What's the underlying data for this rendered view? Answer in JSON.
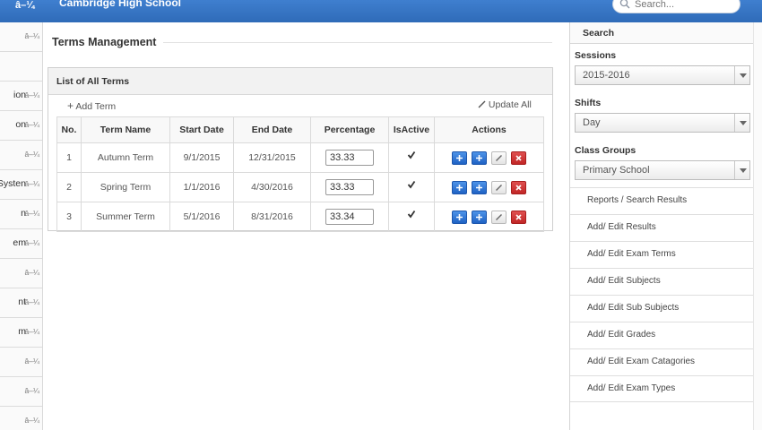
{
  "header": {
    "glyph": "â–¼",
    "school_name": "Cambridge High School",
    "search_placeholder": "Search..."
  },
  "left_nav": {
    "items": [
      {
        "label": "",
        "glyph": "â–¼"
      },
      {
        "label": "",
        "glyph": ""
      },
      {
        "label": "ion",
        "glyph": "â–¼"
      },
      {
        "label": "on",
        "glyph": "â–¼"
      },
      {
        "label": "",
        "glyph": "â–¼"
      },
      {
        "label": "Systen",
        "glyph": "â–¼"
      },
      {
        "label": "n",
        "glyph": "â–¼"
      },
      {
        "label": "em",
        "glyph": "â–¼"
      },
      {
        "label": "",
        "glyph": "â–¼"
      },
      {
        "label": "nt",
        "glyph": "â–¼"
      },
      {
        "label": "m",
        "glyph": "â–¼"
      },
      {
        "label": "",
        "glyph": "â–¼"
      },
      {
        "label": "",
        "glyph": "â–¼"
      },
      {
        "label": "",
        "glyph": "â–¼"
      }
    ]
  },
  "main": {
    "title": "Terms Management",
    "panel_title": "List of All Terms",
    "add_term_label": "Add Term",
    "update_all_label": "Update All",
    "columns": [
      "No.",
      "Term Name",
      "Start Date",
      "End Date",
      "Percentage",
      "IsActive",
      "Actions"
    ],
    "rows": [
      {
        "no": "1",
        "name": "Autumn Term",
        "start": "9/1/2015",
        "end": "12/31/2015",
        "percentage": "33.33",
        "active": true
      },
      {
        "no": "2",
        "name": "Spring Term",
        "start": "1/1/2016",
        "end": "4/30/2016",
        "percentage": "33.33",
        "active": true
      },
      {
        "no": "3",
        "name": "Summer Term",
        "start": "5/1/2016",
        "end": "8/31/2016",
        "percentage": "33.34",
        "active": true
      }
    ]
  },
  "right_nav": {
    "search_title": "Search",
    "sessions_label": "Sessions",
    "sessions_value": "2015-2016",
    "shifts_label": "Shifts",
    "shifts_value": "Day",
    "class_groups_label": "Class Groups",
    "class_groups_value": "Primary School",
    "links": [
      "Reports / Search Results",
      "Add/ Edit Results",
      "Add/ Edit Exam Terms",
      "Add/ Edit Subjects",
      "Add/ Edit Sub Subjects",
      "Add/ Edit Grades",
      "Add/ Edit Exam Catagories",
      "Add/ Edit Exam Types"
    ]
  },
  "colors": {
    "header_blue": "#2f6bb8",
    "action_blue": "#1f62c4",
    "action_red": "#c12626"
  }
}
